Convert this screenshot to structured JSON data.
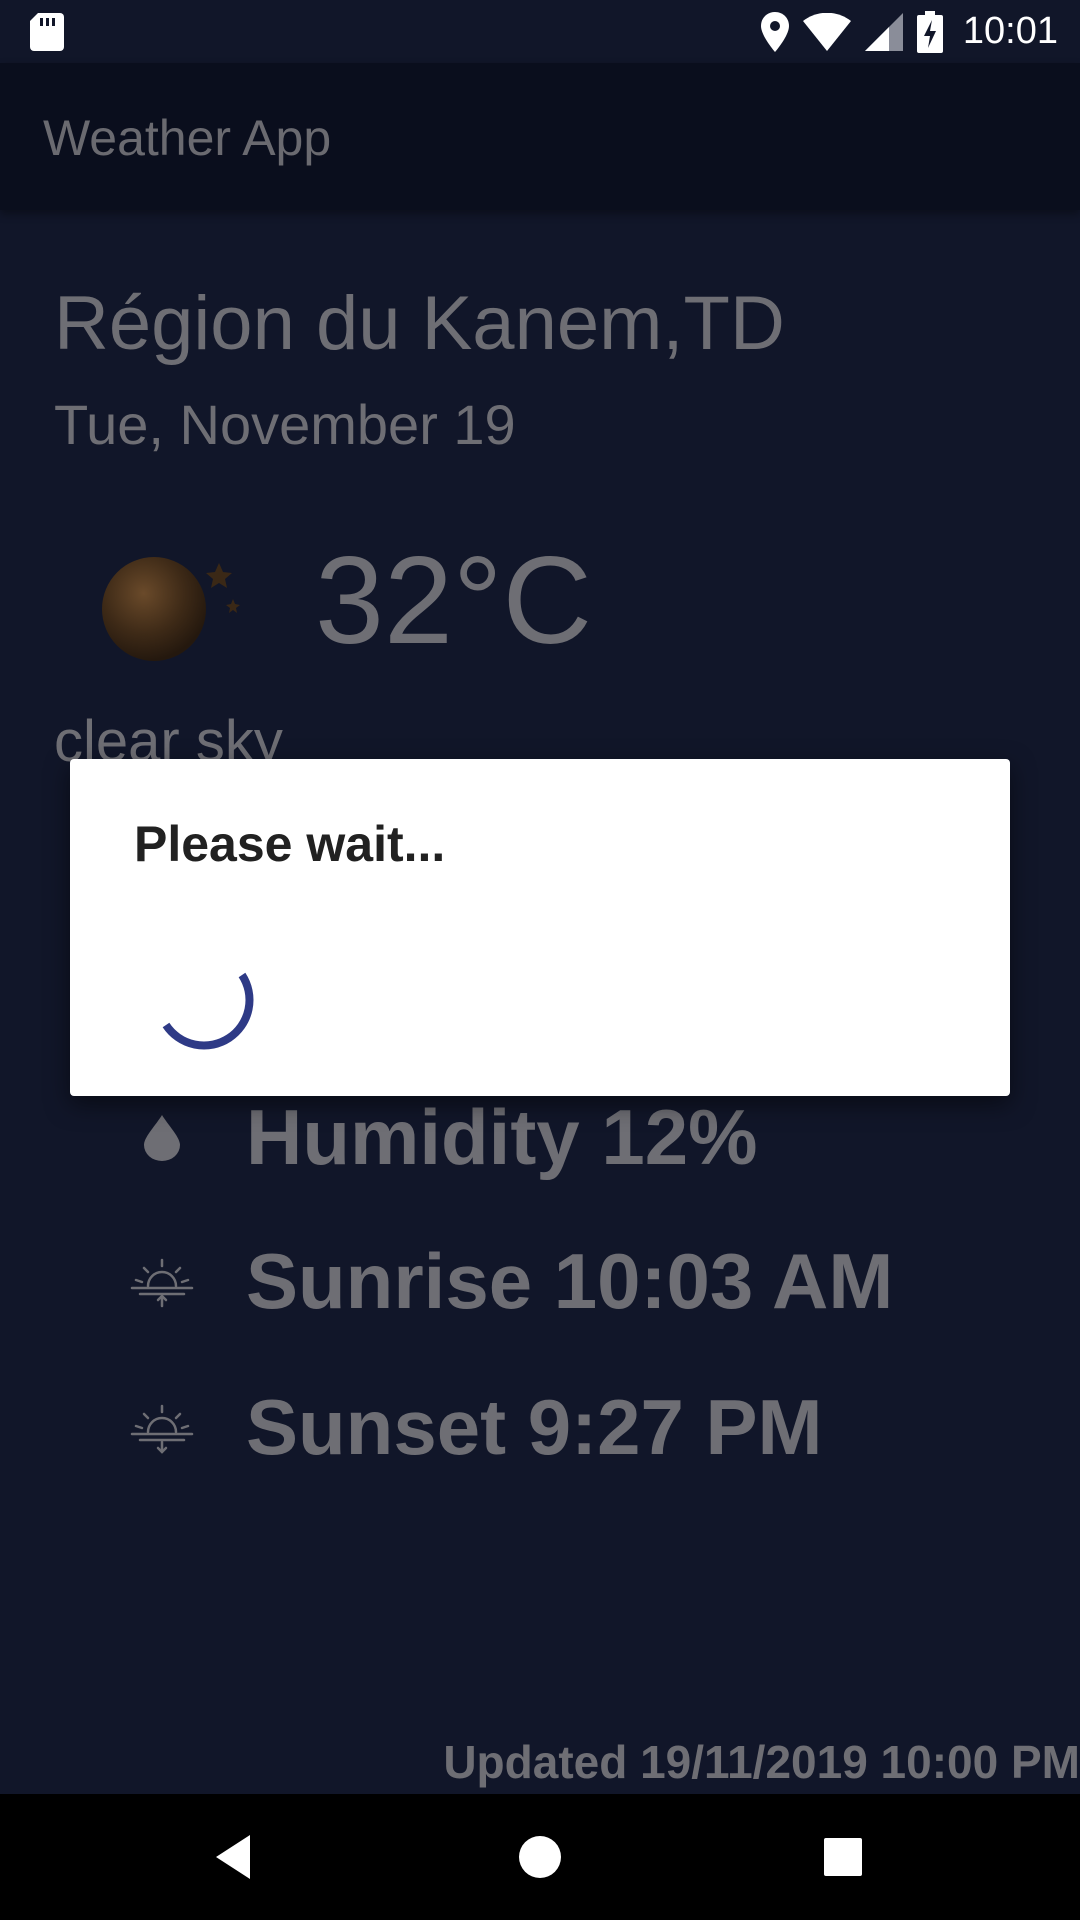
{
  "status_bar": {
    "time": "10:01",
    "icons": [
      "sd-card-icon",
      "location-pin-icon",
      "wifi-icon",
      "cell-signal-icon",
      "battery-charging-icon"
    ]
  },
  "app_bar": {
    "title": "Weather App"
  },
  "weather": {
    "location": "Région du Kanem,TD",
    "date": "Tue, November 19",
    "icon": "moon-stars-icon",
    "temperature": "32°C",
    "description": "clear sky",
    "details": [
      {
        "icon": "water-drop-icon",
        "text": "Humidity 12%"
      },
      {
        "icon": "sunrise-icon",
        "text": "Sunrise 10:03 AM"
      },
      {
        "icon": "sunset-icon",
        "text": "Sunset 9:27 PM"
      }
    ],
    "updated": "Updated 19/11/2019  10:00 PM"
  },
  "dialog": {
    "title": "Please wait..."
  },
  "colors": {
    "background": "#111629",
    "app_bar": "#0a0e1d",
    "dim_text": "#6e6e74",
    "spinner": "#2e3a86"
  },
  "nav_bar": {
    "icons": [
      "back-icon",
      "home-icon",
      "recents-icon"
    ]
  }
}
